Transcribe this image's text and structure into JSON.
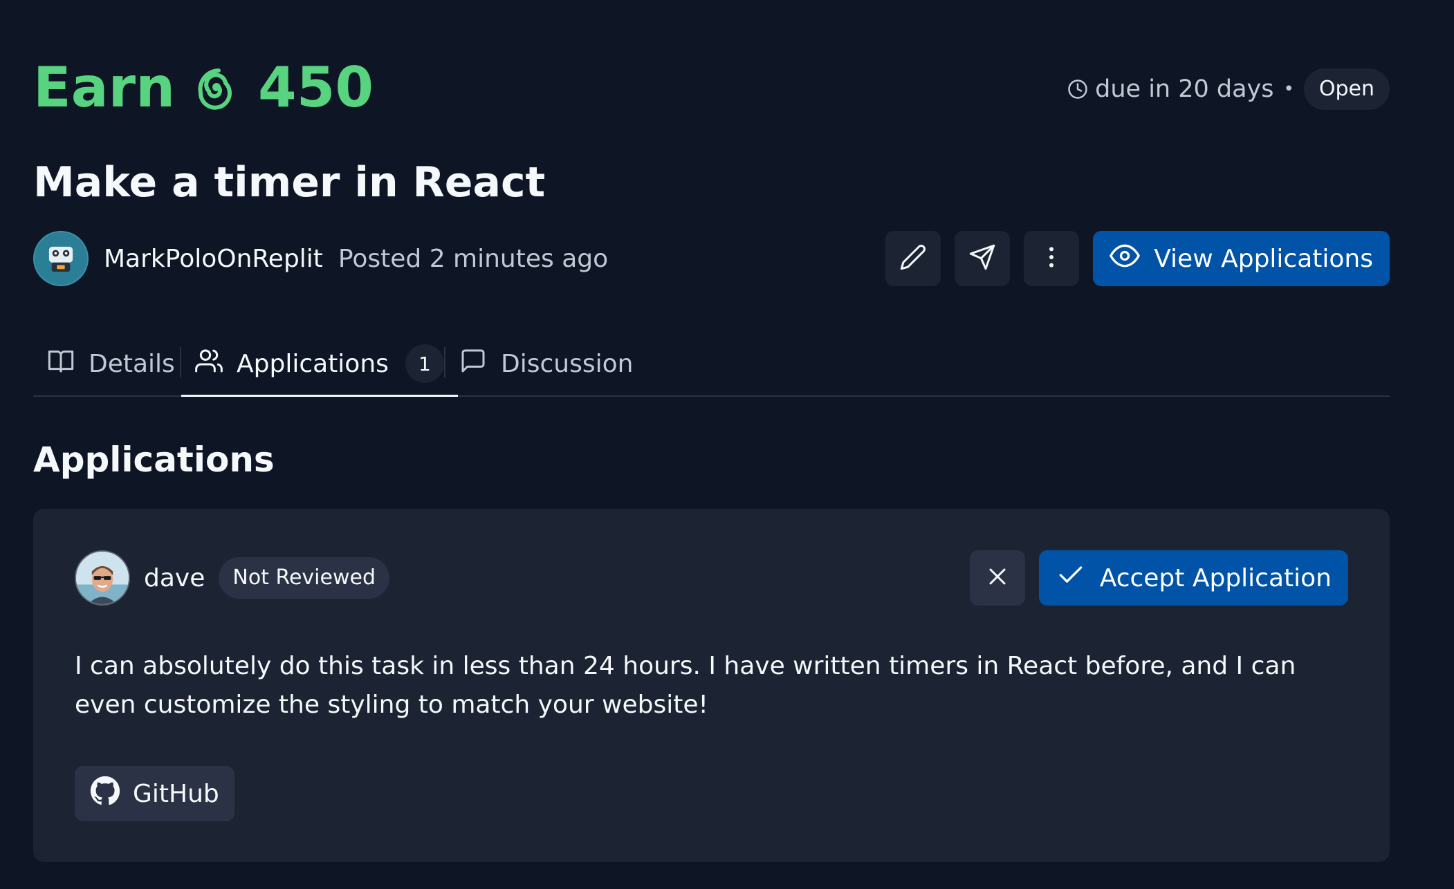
{
  "bounty": {
    "earn_label": "Earn",
    "amount": "450",
    "currency_icon": "cycles-icon",
    "due_text": "due in 20 days",
    "separator": "•",
    "status": "Open",
    "title": "Make a timer in React"
  },
  "author": {
    "name": "MarkPoloOnReplit",
    "posted": "Posted 2 minutes ago"
  },
  "actions": {
    "edit_icon": "pencil-icon",
    "share_icon": "send-icon",
    "more_icon": "more-vertical-icon",
    "view_applications_label": "View Applications"
  },
  "tabs": [
    {
      "label": "Details",
      "icon": "book-open-icon"
    },
    {
      "label": "Applications",
      "icon": "users-icon",
      "count": "1"
    },
    {
      "label": "Discussion",
      "icon": "message-square-icon"
    }
  ],
  "applications_section": {
    "title": "Applications",
    "items": [
      {
        "name": "dave",
        "status": "Not Reviewed",
        "reject_icon": "close-icon",
        "accept_label": "Accept Application",
        "message": "I can absolutely do this task in less than 24 hours. I have written timers in React before, and I can even customize the styling to match your website!",
        "link_label": "GitHub"
      }
    ]
  },
  "colors": {
    "background": "#0e1525",
    "surface": "#1c2333",
    "surface_raised": "#2b3245",
    "accent_green": "#58d480",
    "primary_blue": "#0053a6",
    "text_primary": "#f5f9fc",
    "text_secondary": "#c2c8d4"
  }
}
